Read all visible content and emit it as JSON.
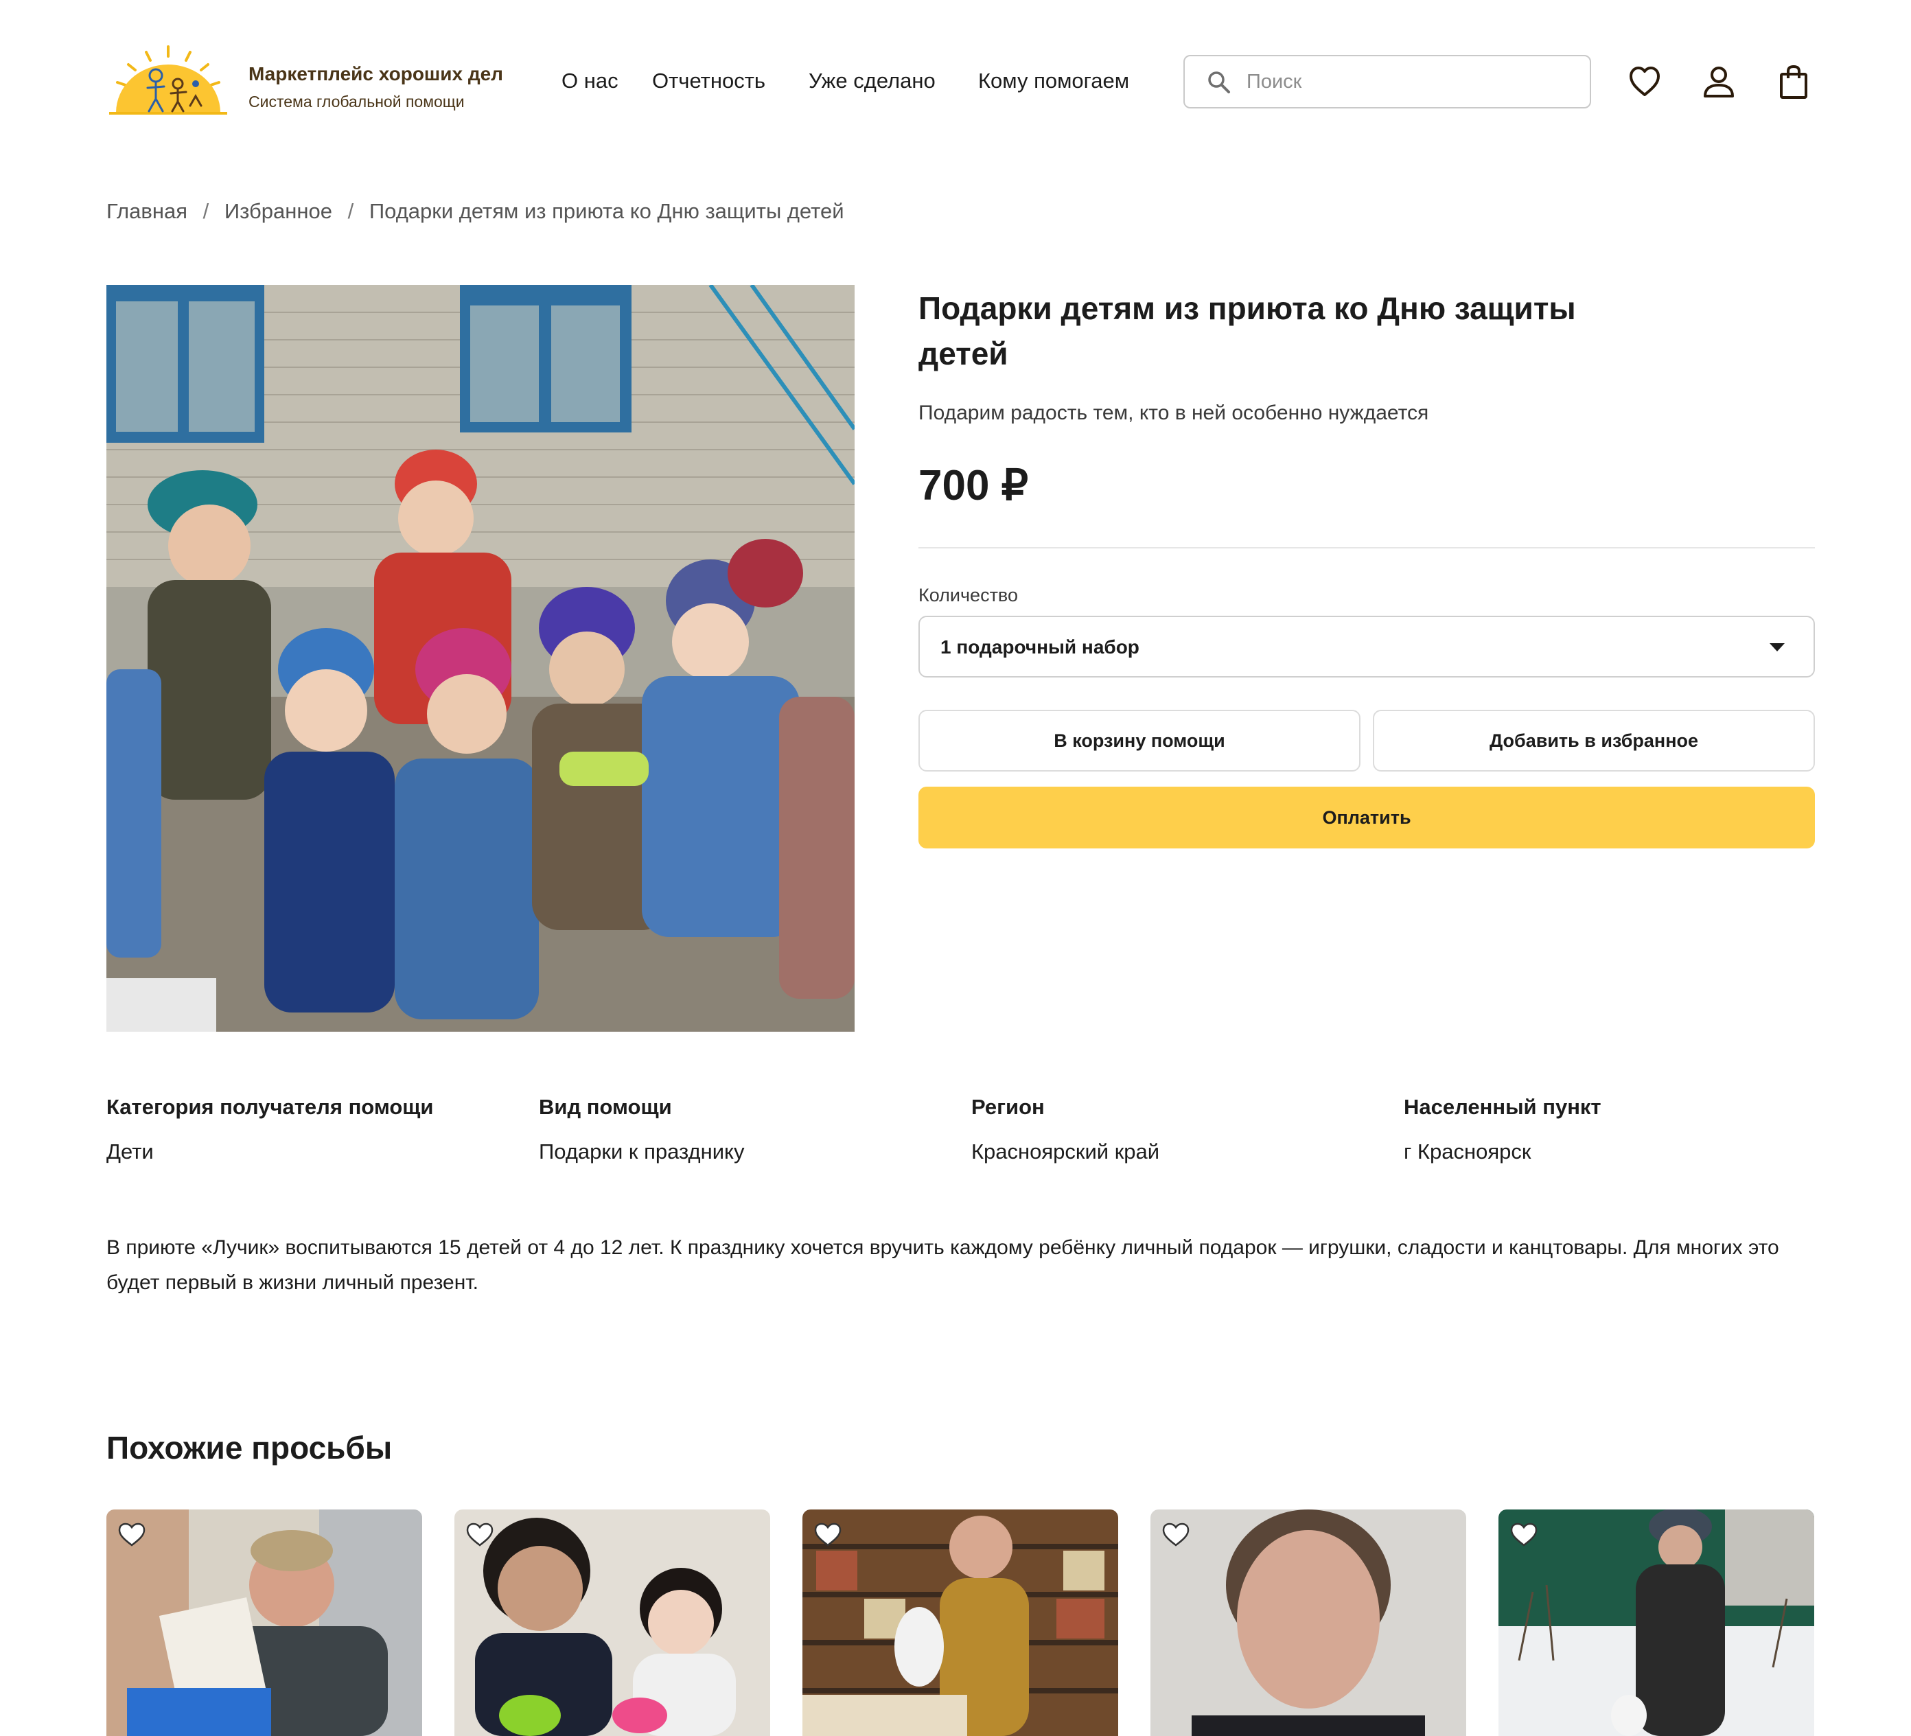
{
  "header": {
    "brand_title": "Маркетплейс хороших дел",
    "brand_subtitle": "Система глобальной помощи",
    "nav": [
      "О нас",
      "Отчетность",
      "Уже сделано",
      "Кому помогаем"
    ],
    "search_placeholder": "Поиск",
    "icons": [
      "heart-icon",
      "user-icon",
      "bag-icon"
    ]
  },
  "breadcrumb": {
    "items": [
      "Главная",
      "Избранное",
      "Подарки детям из приюта ко Дню защиты детей"
    ],
    "separator": "/"
  },
  "product": {
    "title": "Подарки детям из приюта ко Дню защиты детей",
    "subtitle": "Подарим радость тем, кто в ней особенно нуждается",
    "price": "700 ₽",
    "quantity_label": "Количество",
    "quantity_value": "1 подарочный набор",
    "cart_button": "В корзину помощи",
    "favorite_button": "Добавить в избранное",
    "pay_button": "Оплатить"
  },
  "attributes": [
    {
      "label": "Категория получателя помощи",
      "value": "Дети"
    },
    {
      "label": "Вид помощи",
      "value": "Подарки к празднику"
    },
    {
      "label": "Регион",
      "value": "Красноярский край"
    },
    {
      "label": "Населенный пункт",
      "value": "г Красноярск"
    }
  ],
  "description": "В приюте «Лучик» воспитываются 15 детей от 4 до 12 лет. К празднику хочется вручить каждому ребёнку личный подарок — игрушки, сладости и канцтовары. Для многих это будет первый в жизни личный презент.",
  "similar": {
    "title": "Похожие просьбы"
  },
  "colors": {
    "accent": "#fecf4b",
    "brand_text": "#4a3518",
    "text": "#1c1c1c",
    "border": "#cfcfcf"
  }
}
